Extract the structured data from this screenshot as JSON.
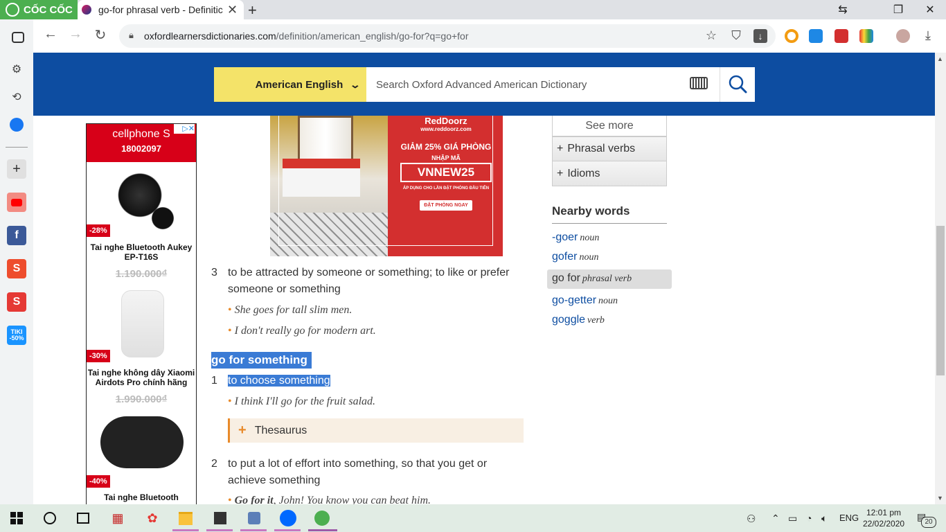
{
  "browser": {
    "brand": "CỐC CỐC",
    "tab_title": "go-for phrasal verb - Definitic",
    "new_tab": "+",
    "url_host": "oxfordlearnersdictionaries.com",
    "url_path": "/definition/american_english/go-for?q=go+for",
    "min": "⇆",
    "max": "❐",
    "close": "✕"
  },
  "header": {
    "language": "American English",
    "search_placeholder": "Search Oxford Advanced American Dictionary"
  },
  "left_ad": {
    "brand": "cellphone S",
    "phone": "18002097",
    "products": [
      {
        "discount": "-28%",
        "name": "Tai nghe Bluetooth Aukey EP-T16S",
        "price": "1.190.000₫"
      },
      {
        "discount": "-30%",
        "name": "Tai nghe không dây Xiaomi Airdots Pro chính hãng",
        "price": "1.990.000₫"
      },
      {
        "discount": "-40%",
        "name": "Tai nghe Bluetooth",
        "price": ""
      }
    ]
  },
  "hotel_ad": {
    "brand": "RedDoorz",
    "site": "www.reddoorz.com",
    "promo": "GIẢM 25% GIÁ PHÒNG",
    "code_label": "NHẬP MÃ",
    "code": "VNNEW25",
    "note": "ÁP DỤNG CHO LẦN ĐẶT PHÒNG ĐẦU TIÊN",
    "cta": "ĐẶT PHÒNG NGAY"
  },
  "entry": {
    "sense3": {
      "num": "3",
      "def": "to be attracted by someone or something; to like or prefer someone or something",
      "examples": [
        "She goes for tall slim men.",
        "I don't really go for modern art."
      ]
    },
    "sub_headword": "go for something",
    "sense1": {
      "num": "1",
      "def": "to choose something",
      "example": "I think I'll go for the fruit salad."
    },
    "thesaurus": "Thesaurus",
    "sense2": {
      "num": "2",
      "def": "to put a lot of effort into something, so that you get or achieve something",
      "example_bold": "Go for it",
      "example_rest": ", John! You know you can beat him."
    }
  },
  "sidebar": {
    "see_more": "See more",
    "phrasal_verbs": "Phrasal verbs",
    "idioms": "Idioms",
    "nearby_title": "Nearby words",
    "nearby": [
      {
        "word": "-goer",
        "pos": "noun"
      },
      {
        "word": "gofer",
        "pos": "noun"
      },
      {
        "word": "go for",
        "pos": "phrasal verb"
      },
      {
        "word": "go-getter",
        "pos": "noun"
      },
      {
        "word": "goggle",
        "pos": "verb"
      }
    ]
  },
  "taskbar": {
    "lang": "ENG",
    "time": "12:01 pm",
    "date": "22/02/2020",
    "notifications": "20"
  },
  "colors": {
    "header_blue": "#0d4da1",
    "lang_yellow": "#f4e369",
    "selection": "#3a7bd5",
    "accent_orange": "#e88a2a",
    "ad_red": "#d70018"
  }
}
